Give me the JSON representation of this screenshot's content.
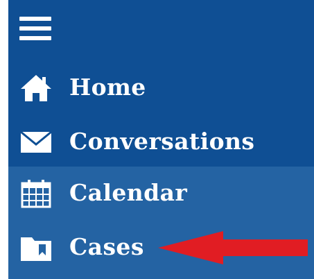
{
  "nav": {
    "menu_icon": "hamburger-menu-icon",
    "items": [
      {
        "label": "Home",
        "icon": "home-icon"
      },
      {
        "label": "Conversations",
        "icon": "envelope-icon"
      },
      {
        "label": "Calendar",
        "icon": "calendar-icon"
      },
      {
        "label": "Cases",
        "icon": "folder-icon"
      }
    ]
  },
  "annotation": {
    "arrow_color": "#e11d23",
    "points_to": "Cases"
  },
  "colors": {
    "sidebar_bg": "#0f4f94",
    "highlight_bg": "#2463a3",
    "text": "#ffffff"
  }
}
